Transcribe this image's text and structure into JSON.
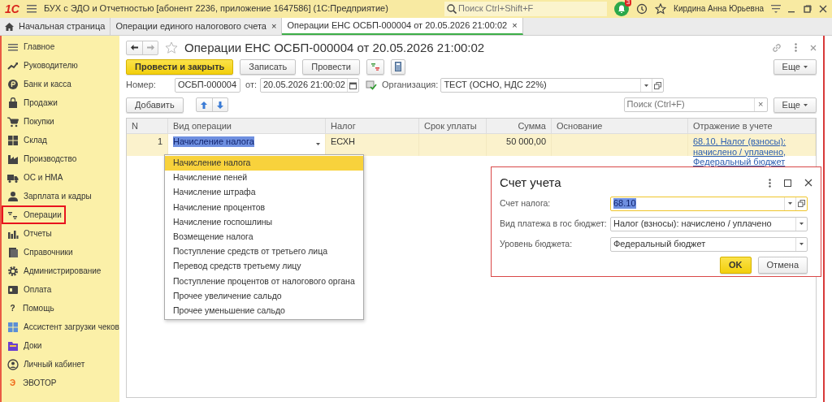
{
  "app": {
    "logo": "1С",
    "title": "БУХ с ЭДО и Отчетностью [абонент 2236, приложение 1647586]  (1С:Предприятие)",
    "search_placeholder": "Поиск Ctrl+Shift+F",
    "notifications": "3",
    "user": "Кирдина Анна Юрьевна"
  },
  "tabs": [
    {
      "label": "Начальная страница",
      "kind": "home",
      "selected": false
    },
    {
      "label": "Операции единого налогового счета",
      "kind": "closable",
      "close": "×",
      "selected": false
    },
    {
      "label": "Операции ЕНС ОСБП-000004 от 20.05.2026 21:00:02",
      "kind": "closable",
      "close": "×",
      "selected": true
    }
  ],
  "sidebar": {
    "items": [
      {
        "label": "Главное",
        "selected": false
      },
      {
        "label": "Руководителю",
        "selected": false
      },
      {
        "label": "Банк и касса",
        "selected": false
      },
      {
        "label": "Продажи",
        "selected": false
      },
      {
        "label": "Покупки",
        "selected": false
      },
      {
        "label": "Склад",
        "selected": false
      },
      {
        "label": "Производство",
        "selected": false
      },
      {
        "label": "ОС и НМА",
        "selected": false
      },
      {
        "label": "Зарплата и кадры",
        "selected": false
      },
      {
        "label": "Операции",
        "selected": true
      },
      {
        "label": "Отчеты",
        "selected": false
      },
      {
        "label": "Справочники",
        "selected": false
      },
      {
        "label": "Администрирование",
        "selected": false
      },
      {
        "label": "Оплата",
        "selected": false
      },
      {
        "label": "Помощь",
        "glyph": "?",
        "selected": false
      },
      {
        "label": "Ассистент загрузки чеков",
        "selected": false
      },
      {
        "label": "Доки",
        "selected": false
      },
      {
        "label": "Личный кабинет",
        "selected": false
      },
      {
        "label": "ЭВОТОР",
        "glyph": "Э",
        "selected": false
      }
    ]
  },
  "document": {
    "title": "Операции ЕНС ОСБП-000004 от 20.05.2026 21:00:02",
    "buttons": [
      {
        "label": "Провести и закрыть",
        "default": true
      },
      {
        "label": "Записать",
        "default": false
      },
      {
        "label": "Провести",
        "default": false
      }
    ],
    "more": "Еще",
    "number_label": "Номер:",
    "number": "ОСБП-000004",
    "date_label": "от:",
    "date": "20.05.2026 21:00:02",
    "org_label": "Организация:",
    "org": "ТЕСТ (ОСНО, НДС 22%)"
  },
  "table": {
    "add_button": "Добавить",
    "search_placeholder": "Поиск (Ctrl+F)",
    "search_clear": "×",
    "more": "Еще",
    "columns": [
      "N",
      "Вид операции",
      "Налог",
      "Срок уплаты",
      "Сумма",
      "Основание",
      "Отражение в учете"
    ],
    "rows": [
      {
        "n": "1",
        "operation": "Начисление налога",
        "tax": "ЕСХН",
        "amount": "50 000,00",
        "reflection": "68.10, Налог (взносы): начислено / уплачено, Федеральный бюджет",
        "selected": true
      }
    ]
  },
  "dropdown": {
    "items": [
      {
        "label": "Начисление налога",
        "selected": true
      },
      {
        "label": "Начисление пеней",
        "selected": false
      },
      {
        "label": "Начисление штрафа",
        "selected": false
      },
      {
        "label": "Начисление процентов",
        "selected": false
      },
      {
        "label": "Начисление госпошлины",
        "selected": false
      },
      {
        "label": "Возмещение налога",
        "selected": false
      },
      {
        "label": "Поступление средств от третьего лица",
        "selected": false
      },
      {
        "label": "Перевод средств третьему лицу",
        "selected": false
      },
      {
        "label": "Поступление процентов от налогового органа",
        "selected": false
      },
      {
        "label": "Прочее увеличение сальдо",
        "selected": false
      },
      {
        "label": "Прочее уменьшение сальдо",
        "selected": false
      }
    ]
  },
  "dialog": {
    "title": "Счет учета",
    "fields": [
      {
        "label": "Счет налога:",
        "value": "68.10",
        "focused": true,
        "open_button": true
      },
      {
        "label": "Вид платежа в гос бюджет:",
        "value": "Налог (взносы): начислено / уплачено",
        "focused": false,
        "open_button": false
      },
      {
        "label": "Уровень бюджета:",
        "value": "Федеральный бюджет",
        "focused": false,
        "open_button": false
      }
    ],
    "buttons": [
      {
        "label": "OK",
        "default": true
      },
      {
        "label": "Отмена",
        "default": false
      }
    ]
  }
}
